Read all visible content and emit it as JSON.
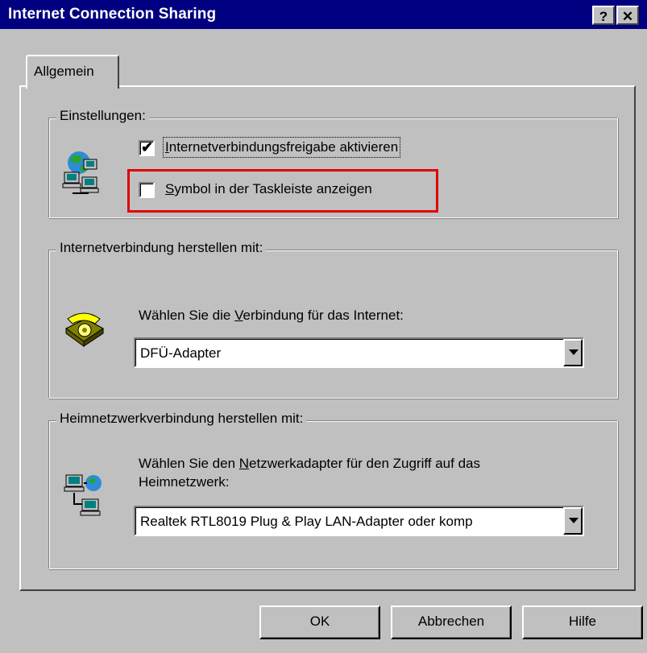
{
  "window": {
    "title": "Internet Connection Sharing",
    "help_button": "?",
    "close_button": "✕"
  },
  "tabs": [
    {
      "label": "Allgemein"
    }
  ],
  "settings_group": {
    "legend": "Einstellungen:",
    "enable_sharing": {
      "label_access_key": "I",
      "label_rest": "nternetverbindungsfreigabe aktivieren",
      "checked": true
    },
    "show_taskbar_icon": {
      "label_access_key": "S",
      "label_rest": "ymbol in der Taskleiste anzeigen",
      "checked": false
    }
  },
  "internet_group": {
    "legend": "Internetverbindung herstellen mit:",
    "prompt_before": "Wählen Sie die ",
    "prompt_access_key": "V",
    "prompt_after": "erbindung für das Internet:",
    "selected_value": "DFÜ-Adapter"
  },
  "home_group": {
    "legend": "Heimnetzwerkverbindung herstellen mit:",
    "prompt_before": "Wählen Sie den ",
    "prompt_access_key": "N",
    "prompt_after": "etzwerkadapter für den Zugriff auf das",
    "prompt_line2": "Heimnetzwerk:",
    "selected_value": "Realtek RTL8019 Plug & Play LAN-Adapter oder komp"
  },
  "buttons": {
    "ok": "OK",
    "cancel": "Abbrechen",
    "help": "Hilfe"
  },
  "colors": {
    "titlebar": "#000080",
    "face": "#c0c0c0",
    "highlight": "#e0000a"
  }
}
